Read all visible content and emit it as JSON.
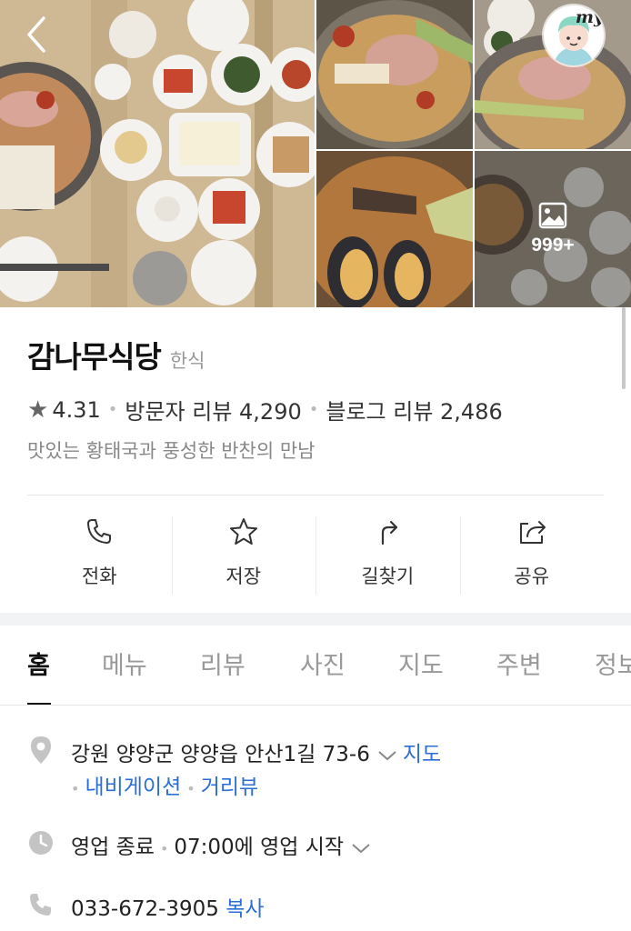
{
  "gallery": {
    "photo_count": "999+",
    "my_label": "my"
  },
  "place": {
    "name": "감나무식당",
    "category": "한식",
    "rating": "4.31",
    "visitor_review_label": "방문자 리뷰 4,290",
    "blog_review_label": "블로그 리뷰 2,486",
    "tagline": "맛있는 황태국과 풍성한 반찬의 만남"
  },
  "actions": [
    {
      "label": "전화",
      "icon": "phone-icon"
    },
    {
      "label": "저장",
      "icon": "star-icon"
    },
    {
      "label": "길찾기",
      "icon": "directions-icon"
    },
    {
      "label": "공유",
      "icon": "share-icon"
    }
  ],
  "tabs": [
    {
      "label": "홈",
      "active": true
    },
    {
      "label": "메뉴"
    },
    {
      "label": "리뷰"
    },
    {
      "label": "사진"
    },
    {
      "label": "지도"
    },
    {
      "label": "주변"
    },
    {
      "label": "정보"
    }
  ],
  "info": {
    "address": "강원 양양군 양양읍 안산1길 73-6",
    "map_link": "지도",
    "navigation_link": "내비게이션",
    "street_view_link": "거리뷰",
    "hours_status": "영업 종료",
    "hours_next": "07:00에 영업 시작",
    "phone": "033-672-3905",
    "copy_link": "복사"
  },
  "colors": {
    "link_blue": "#2b6fd6",
    "text_dark": "#222222",
    "text_grey": "#999999"
  }
}
